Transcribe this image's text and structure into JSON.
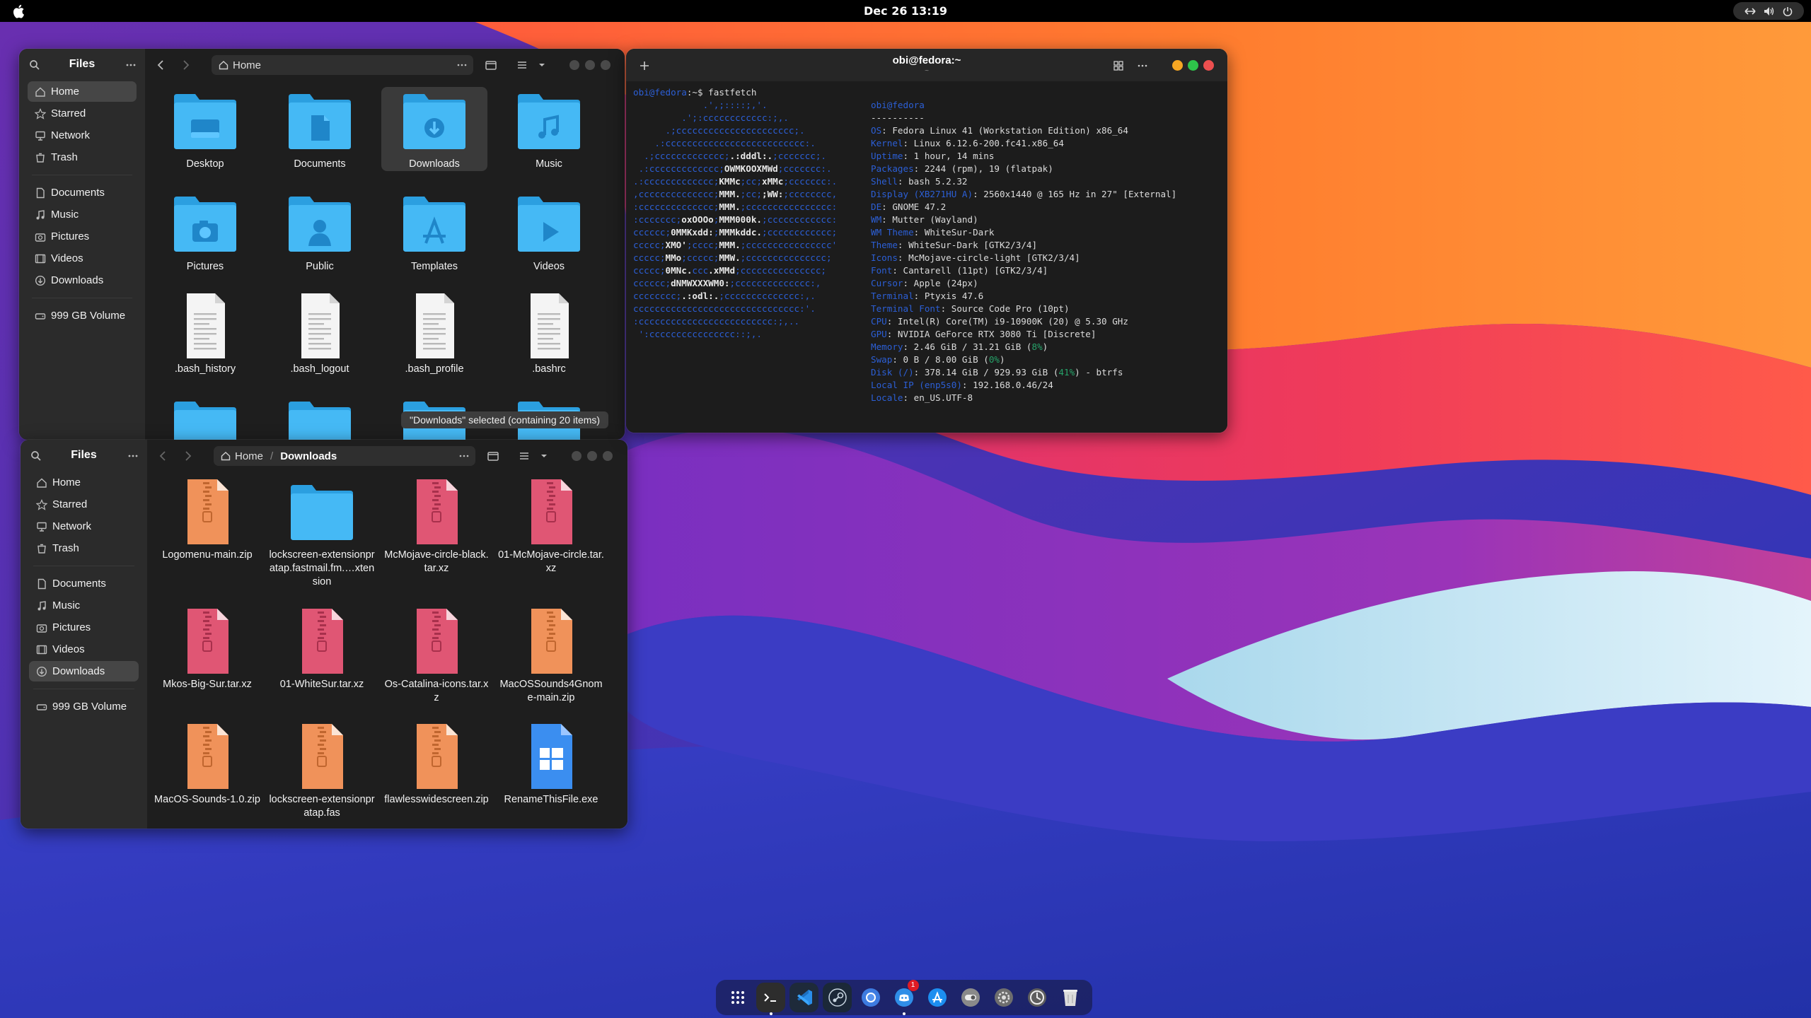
{
  "topbar": {
    "clock": "Dec 26  13:19",
    "apple_icon": "apple-icon",
    "tray_icons": [
      "network-icon",
      "volume-icon",
      "power-icon"
    ]
  },
  "files_top": {
    "title": "Files",
    "path": [
      "Home"
    ],
    "sidebar": {
      "places": [
        "Home",
        "Starred",
        "Network",
        "Trash"
      ],
      "folders": [
        "Documents",
        "Music",
        "Pictures",
        "Videos",
        "Downloads"
      ],
      "volume": "999 GB Volume",
      "active": "Home"
    },
    "items": [
      {
        "label": "Desktop",
        "kind": "folder",
        "glyph": "desktop"
      },
      {
        "label": "Documents",
        "kind": "folder",
        "glyph": "document"
      },
      {
        "label": "Downloads",
        "kind": "folder",
        "glyph": "download"
      },
      {
        "label": "Music",
        "kind": "folder",
        "glyph": "music"
      },
      {
        "label": "Pictures",
        "kind": "folder",
        "glyph": "camera"
      },
      {
        "label": "Public",
        "kind": "folder",
        "glyph": "person"
      },
      {
        "label": "Templates",
        "kind": "folder",
        "glyph": "appstore"
      },
      {
        "label": "Videos",
        "kind": "folder",
        "glyph": "play"
      },
      {
        "label": ".bash_history",
        "kind": "text"
      },
      {
        "label": ".bash_logout",
        "kind": "text"
      },
      {
        "label": ".bash_profile",
        "kind": "text"
      },
      {
        "label": ".bashrc",
        "kind": "text"
      }
    ],
    "selected": "Downloads",
    "status": "\"Downloads\" selected  (containing 20 items)"
  },
  "files_bottom": {
    "title": "Files",
    "path": [
      "Home",
      "Downloads"
    ],
    "sidebar": {
      "places": [
        "Home",
        "Starred",
        "Network",
        "Trash"
      ],
      "folders": [
        "Documents",
        "Music",
        "Pictures",
        "Videos",
        "Downloads"
      ],
      "volume": "999 GB Volume",
      "active": "Downloads"
    },
    "items": [
      {
        "label": "Logomenu-main.zip",
        "kind": "archive-orange"
      },
      {
        "label": "lockscreen-extensionpratap.fastmail.fm.…xtension",
        "kind": "folder"
      },
      {
        "label": "McMojave-circle-black.tar.xz",
        "kind": "archive-red"
      },
      {
        "label": "01-McMojave-circle.tar.xz",
        "kind": "archive-red"
      },
      {
        "label": "Mkos-Big-Sur.tar.xz",
        "kind": "archive-red"
      },
      {
        "label": "01-WhiteSur.tar.xz",
        "kind": "archive-red"
      },
      {
        "label": "Os-Catalina-icons.tar.xz",
        "kind": "archive-red"
      },
      {
        "label": "MacOSSounds4Gnome-main.zip",
        "kind": "archive-orange"
      },
      {
        "label": "MacOS-Sounds-1.0.zip",
        "kind": "archive-orange"
      },
      {
        "label": "lockscreen-extensionpratap.fas",
        "kind": "archive-orange"
      },
      {
        "label": "flawlesswidescreen.zip",
        "kind": "archive-orange"
      },
      {
        "label": "RenameThisFile.exe",
        "kind": "exe"
      }
    ]
  },
  "terminal": {
    "title": "obi@fedora:~",
    "subtitle": "~",
    "prompt_user": "obi@fedora",
    "prompt_rest": ":~$ fastfetch",
    "logo_lines": [
      "             .',;::::;,'.",
      "         .';:cccccccccccc:;,.",
      "      .;cccccccccccccccccccccc;.",
      "    .:cccccccccccccccccccccccccc:.",
      "  .;ccccccccccccc;<b>.:dddl:.</b>;ccccccc;.",
      " .:ccccccccccccc;<b>OWMKOOXMWd</b>;ccccccc:.",
      ".:ccccccccccccc;<b>KMMc</b>;cc;<b>xMMc</b>;ccccccc:.",
      ",cccccccccccccc;<b>MMM.</b>;cc;<b>;WW:</b>;cccccccc,",
      ":cccccccccccccc;<b>MMM.</b>;cccccccccccccccc:",
      ":ccccccc;<b>oxOOOo</b>;<b>MMM000k.</b>;cccccccccccc:",
      "cccccc;<b>0MMKxdd:</b>;<b>MMMkddc.</b>;cccccccccccc;",
      "ccccc;<b>XMO'</b>;cccc;<b>MMM.</b>;cccccccccccccccc'",
      "ccccc;<b>MMo</b>;ccccc;<b>MMW.</b>;ccccccccccccccc;",
      "ccccc;<b>0MNc.</b>ccc<b>.xMMd</b>;ccccccccccccccc;",
      "cccccc;<b>dNMWXXXWM0:</b>;cccccccccccccc:,",
      "cccccccc;<b>.:odl:.</b>;cccccccccccccc:,.",
      "ccccccccccccccccccccccccccccccc:'.",
      ":ccccccccccccccccccccccccc:;,..",
      " ':cccccccccccccccc::;,."
    ],
    "info": [
      {
        "k": "obi",
        "v": "@fedora",
        "hdr": true
      },
      {
        "k": "",
        "v": "----------"
      },
      {
        "k": "OS",
        "v": "Fedora Linux 41 (Workstation Edition) x86_64"
      },
      {
        "k": "Kernel",
        "v": "Linux 6.12.6-200.fc41.x86_64"
      },
      {
        "k": "Uptime",
        "v": "1 hour, 14 mins"
      },
      {
        "k": "Packages",
        "v": "2244 (rpm), 19 (flatpak)"
      },
      {
        "k": "Shell",
        "v": "bash 5.2.32"
      },
      {
        "k": "Display (XB271HU A)",
        "v": "2560x1440 @ 165 Hz in 27\" [External]"
      },
      {
        "k": "DE",
        "v": "GNOME 47.2"
      },
      {
        "k": "WM",
        "v": "Mutter (Wayland)"
      },
      {
        "k": "WM Theme",
        "v": "WhiteSur-Dark"
      },
      {
        "k": "Theme",
        "v": "WhiteSur-Dark [GTK2/3/4]"
      },
      {
        "k": "Icons",
        "v": "McMojave-circle-light [GTK2/3/4]"
      },
      {
        "k": "Font",
        "v": "Cantarell (11pt) [GTK2/3/4]"
      },
      {
        "k": "Cursor",
        "v": "Apple (24px)"
      },
      {
        "k": "Terminal",
        "v": "Ptyxis 47.6"
      },
      {
        "k": "Terminal Font",
        "v": "Source Code Pro (10pt)"
      },
      {
        "k": "CPU",
        "v": "Intel(R) Core(TM) i9-10900K (20) @ 5.30 GHz"
      },
      {
        "k": "GPU",
        "v": "NVIDIA GeForce RTX 3080 Ti [Discrete]"
      },
      {
        "k": "Memory",
        "v": "2.46 GiB / 31.21 GiB (",
        "pct": "8%",
        "end": ")"
      },
      {
        "k": "Swap",
        "v": "0 B / 8.00 GiB (",
        "pct": "0%",
        "end": ")"
      },
      {
        "k": "Disk (/)",
        "v": "378.14 GiB / 929.93 GiB (",
        "pct": "41%",
        "end": ") - btrfs"
      },
      {
        "k": "Local IP (enp5s0)",
        "v": "192.168.0.46/24"
      },
      {
        "k": "Locale",
        "v": "en_US.UTF-8"
      }
    ],
    "palette": [
      "#c01c28",
      "#26a269",
      "#a2734c",
      "#12488b",
      "#a347ba",
      "#2aa1b3",
      "#d0cfcc"
    ]
  },
  "dock": {
    "apps": [
      "app-grid-icon",
      "terminal-icon",
      "vscode-icon",
      "steam-icon",
      "chromium-icon",
      "discord-icon",
      "app-store-icon",
      "toggle-icon",
      "settings-icon",
      "system-icon",
      "trash-icon"
    ],
    "badge": "1"
  },
  "colors": {
    "folder_blue": "#3fb3f2",
    "archive_orange": "#f0925a",
    "archive_red": "#e05674",
    "accent_blue": "#2c5fd6"
  }
}
